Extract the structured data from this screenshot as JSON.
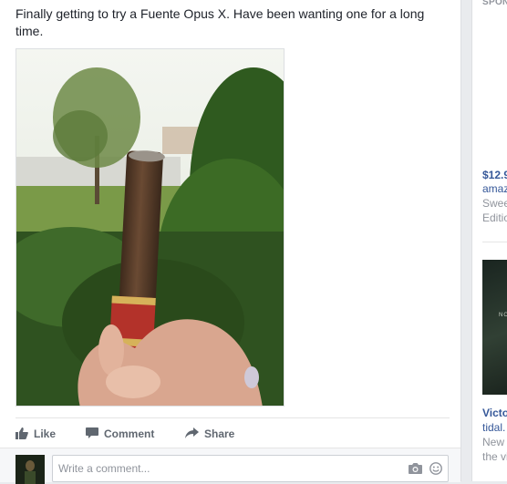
{
  "post": {
    "text": "Finally getting to try a Fuente Opus X. Have been wanting one for a long time."
  },
  "actions": {
    "like": "Like",
    "comment": "Comment",
    "share": "Share"
  },
  "comment_box": {
    "placeholder": "Write a comment..."
  },
  "sidebar": {
    "sponsored": "SPON",
    "ad1": {
      "price": "$12.9",
      "link": "amaz",
      "desc_line1": "Swee",
      "desc_line2": "Editio"
    },
    "ad2": {
      "image_text": "NO",
      "title": "Victo",
      "link": "tidal.",
      "desc_line1": "New",
      "desc_line2": "the vi"
    }
  },
  "colors": {
    "link": "#365899",
    "action_text": "#606770",
    "muted": "#90949c"
  }
}
